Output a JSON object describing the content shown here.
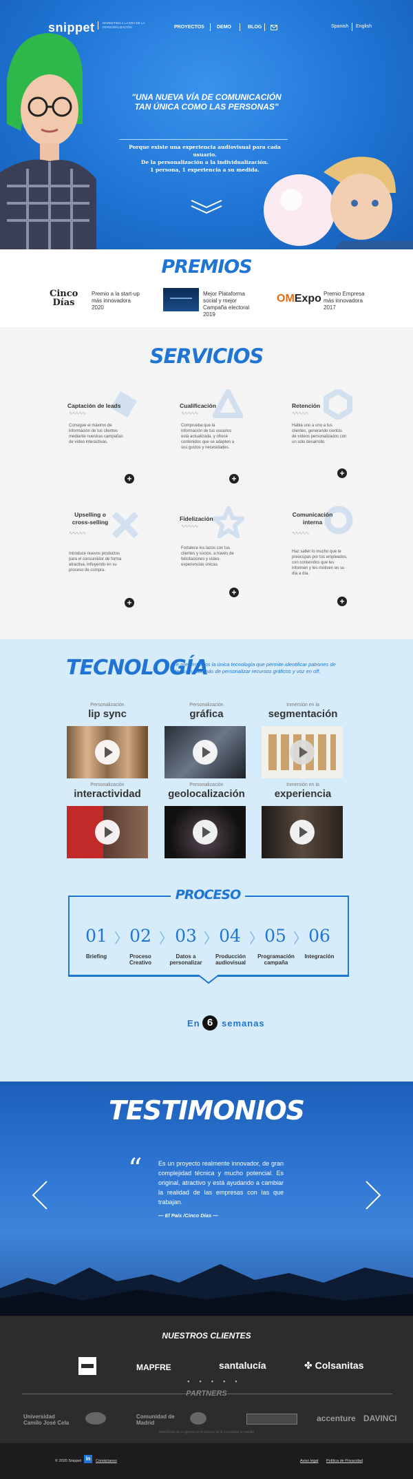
{
  "header": {
    "logo": "snippet",
    "tagline": "MARKETING A LA ERA DE LA PERSONALIZACIÓN",
    "nav": [
      "PROYECTOS",
      "DEMO",
      "BLOG"
    ],
    "languages": [
      "Spanish",
      "English"
    ]
  },
  "hero": {
    "quote": "\"UNA NUEVA VÍA DE COMUNICACIÓN TAN ÚNICA COMO LAS PERSONAS\"",
    "subtitle_lines": [
      "Porque existe una experiencia audiovisual para cada usuario.",
      "De la personalización a la individualización.",
      "1 persona, 1 experiencia a su medida."
    ]
  },
  "premios": {
    "title": "PREMIOS",
    "awards": [
      {
        "logo": "Cinco Días",
        "text": "Premio a la start-up más innovadora 2020"
      },
      {
        "logo": "",
        "text": "Mejor Plataforma social y mejor Campaña electoral 2019"
      },
      {
        "logo": "OMExpo",
        "text": "Premio Empresa más innovadora 2017"
      }
    ]
  },
  "servicios": {
    "title": "SERVICIOS",
    "items": [
      {
        "title": "Captación de leads",
        "desc": "Consigue el máximo de información de tus clientes mediante nuestras campañas de vídeo interactivas.",
        "shape": "diamond"
      },
      {
        "title": "Cualificación",
        "desc": "Comprueba que la información de tus usuarios está actualizada, y ofrece contenidos que se adapten a sus gustos y necesidades.",
        "shape": "triangle"
      },
      {
        "title": "Retención",
        "desc": "Habla uno a uno a tus clientes, generando cientos de vídeos personalizados con un sólo desarrollo",
        "shape": "hexagon"
      },
      {
        "title": "Upselling o cross-selling",
        "desc": "Introduce nuevos productos para el consumidor de forma atractiva, influyendo en su proceso de compra.",
        "shape": "cross"
      },
      {
        "title": "Fidelización",
        "desc": "Fortalece los lazos con tus clientes y socios, a través de felicitaciones y vídeo-experiencias únicas.",
        "shape": "star"
      },
      {
        "title": "Comunicación interna",
        "desc": "Haz saber lo mucho que te preocupas por tus empleados, con contenidos que les informen y les motiven en su día a día.",
        "shape": "circle"
      }
    ]
  },
  "tecnologia": {
    "title": "TECNOLOGÍA",
    "description": "Te presentamos la única tecnología que permite identificar patrones de decisión, además de personalizar recursos gráficos y voz en off.",
    "videos": [
      {
        "kicker": "Personalización",
        "name": "lip sync"
      },
      {
        "kicker": "Personalización",
        "name": "gráfica"
      },
      {
        "kicker": "Inmersión en la",
        "name": "segmentación"
      },
      {
        "kicker": "Personalización",
        "name": "interactividad"
      },
      {
        "kicker": "Personalización",
        "name": "geolocalización"
      },
      {
        "kicker": "Inmersión en la",
        "name": "experiencia"
      }
    ]
  },
  "proceso": {
    "title": "PROCESO",
    "steps": [
      {
        "num": "01",
        "label": "Briefing"
      },
      {
        "num": "02",
        "label": "Proceso Creativo"
      },
      {
        "num": "03",
        "label": "Datos a personalizar"
      },
      {
        "num": "04",
        "label": "Producción audiovisual"
      },
      {
        "num": "05",
        "label": "Programación campaña"
      },
      {
        "num": "06",
        "label": "Integración"
      }
    ],
    "weeks_prefix": "En",
    "weeks_num": "6",
    "weeks_suffix": "semanas"
  },
  "testimonios": {
    "title": "TESTIMONIOS",
    "quote": "Es un proyecto realmente innovador, de gran complejidad técnica y mucho potencial. Es original, atractivo y está ayudando a cambiar la realidad de las empresas con las que trabajan.",
    "author": "— El País /Cinco Días —"
  },
  "clientes": {
    "title": "NUESTROS CLIENTES",
    "logos": [
      "MAPFRE",
      "santalucía",
      "Colsanitas"
    ]
  },
  "partners": {
    "title": "PARTNERS",
    "logos": [
      "Universidad Camilo José Cela",
      "Comunidad de Madrid",
      "accenture",
      "DAVINCI"
    ],
    "note": "Beneficiario de la Agencia de Innovación de la Comunidad de Madrid"
  },
  "footer": {
    "copyright": "© 2020 Snippet",
    "contact": "Contáctanos",
    "links": [
      "Aviso legal",
      "Política de Privacidad"
    ]
  },
  "colors": {
    "primary": "#1f74d4",
    "dark": "#2d2b2b",
    "light_bg": "#d7ecfa"
  }
}
